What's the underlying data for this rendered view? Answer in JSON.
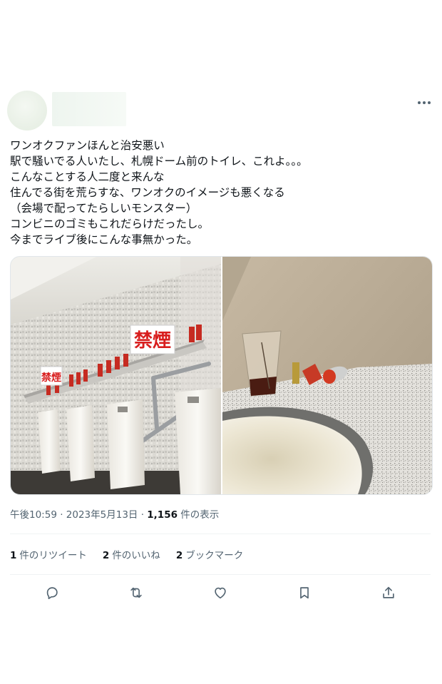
{
  "tweet": {
    "lines": [
      "ワンオクファンほんと治安悪い",
      "駅で騒いでる人いたし、札幌ドーム前のトイレ、これよ。。。",
      "こんなことする人二度と来んな",
      "住んでる街を荒らすな、ワンオクのイメージも悪くなる",
      "（会場で配ってたらしいモンスター）",
      "コンビニのゴミもこれだらけだったし。",
      "今までライブ後にこんな事無かった。"
    ],
    "sign_text": "禁煙"
  },
  "meta": {
    "time": "午後10:59",
    "sep1": " · ",
    "date": "2023年5月13日",
    "sep2": " · ",
    "views_count": "1,156",
    "views_label": " 件の表示"
  },
  "stats": {
    "retweets_count": "1",
    "retweets_label": "件のリツイート",
    "likes_count": "2",
    "likes_label": "件のいいね",
    "bookmarks_count": "2",
    "bookmarks_label": "ブックマーク"
  },
  "icons": {
    "more": "more-icon",
    "reply": "reply-icon",
    "retweet": "retweet-icon",
    "like": "like-icon",
    "bookmark": "bookmark-icon",
    "share": "share-icon"
  },
  "colors": {
    "text": "#0f1419",
    "secondary": "#536471",
    "divider": "#eff3f4",
    "sign_red": "#d81e1e"
  }
}
